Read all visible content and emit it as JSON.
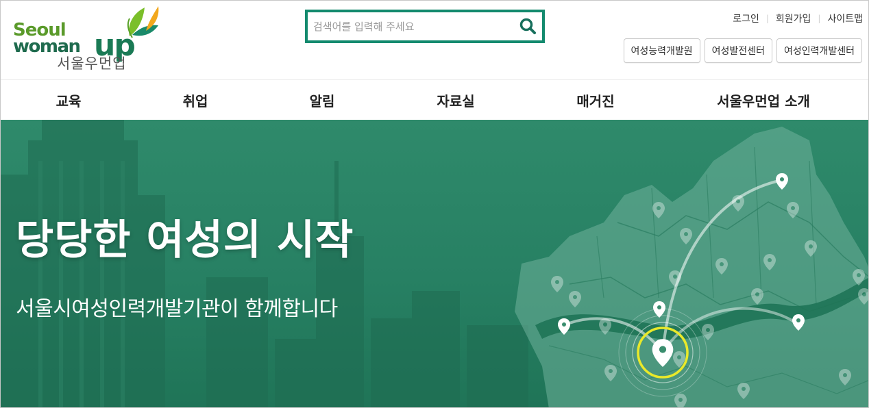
{
  "brand": {
    "logo_seoul": "Seoul",
    "logo_woman": "woman",
    "logo_up": "up",
    "logo_korean": "서울우먼업",
    "leaf_colors": [
      "#7bbf2a",
      "#f2a81d",
      "#1a8a6a"
    ]
  },
  "search": {
    "placeholder": "검색어를 입력해 주세요",
    "value": "",
    "icon": "search-icon",
    "border_color": "#138a6e"
  },
  "util_links": [
    "로그인",
    "회원가입",
    "사이트맵"
  ],
  "quick_links": [
    "여성능력개발원",
    "여성발전센터",
    "여성인력개발센터"
  ],
  "gnb": [
    "교육",
    "취업",
    "알림",
    "자료실",
    "매거진",
    "서울우먼업 소개"
  ],
  "hero": {
    "title": "당당한 여성의 시작",
    "subtitle": "서울시여성인력개발기관이 함께합니다",
    "background_color": "#2a8566",
    "highlight_color": "#e9e92a"
  }
}
